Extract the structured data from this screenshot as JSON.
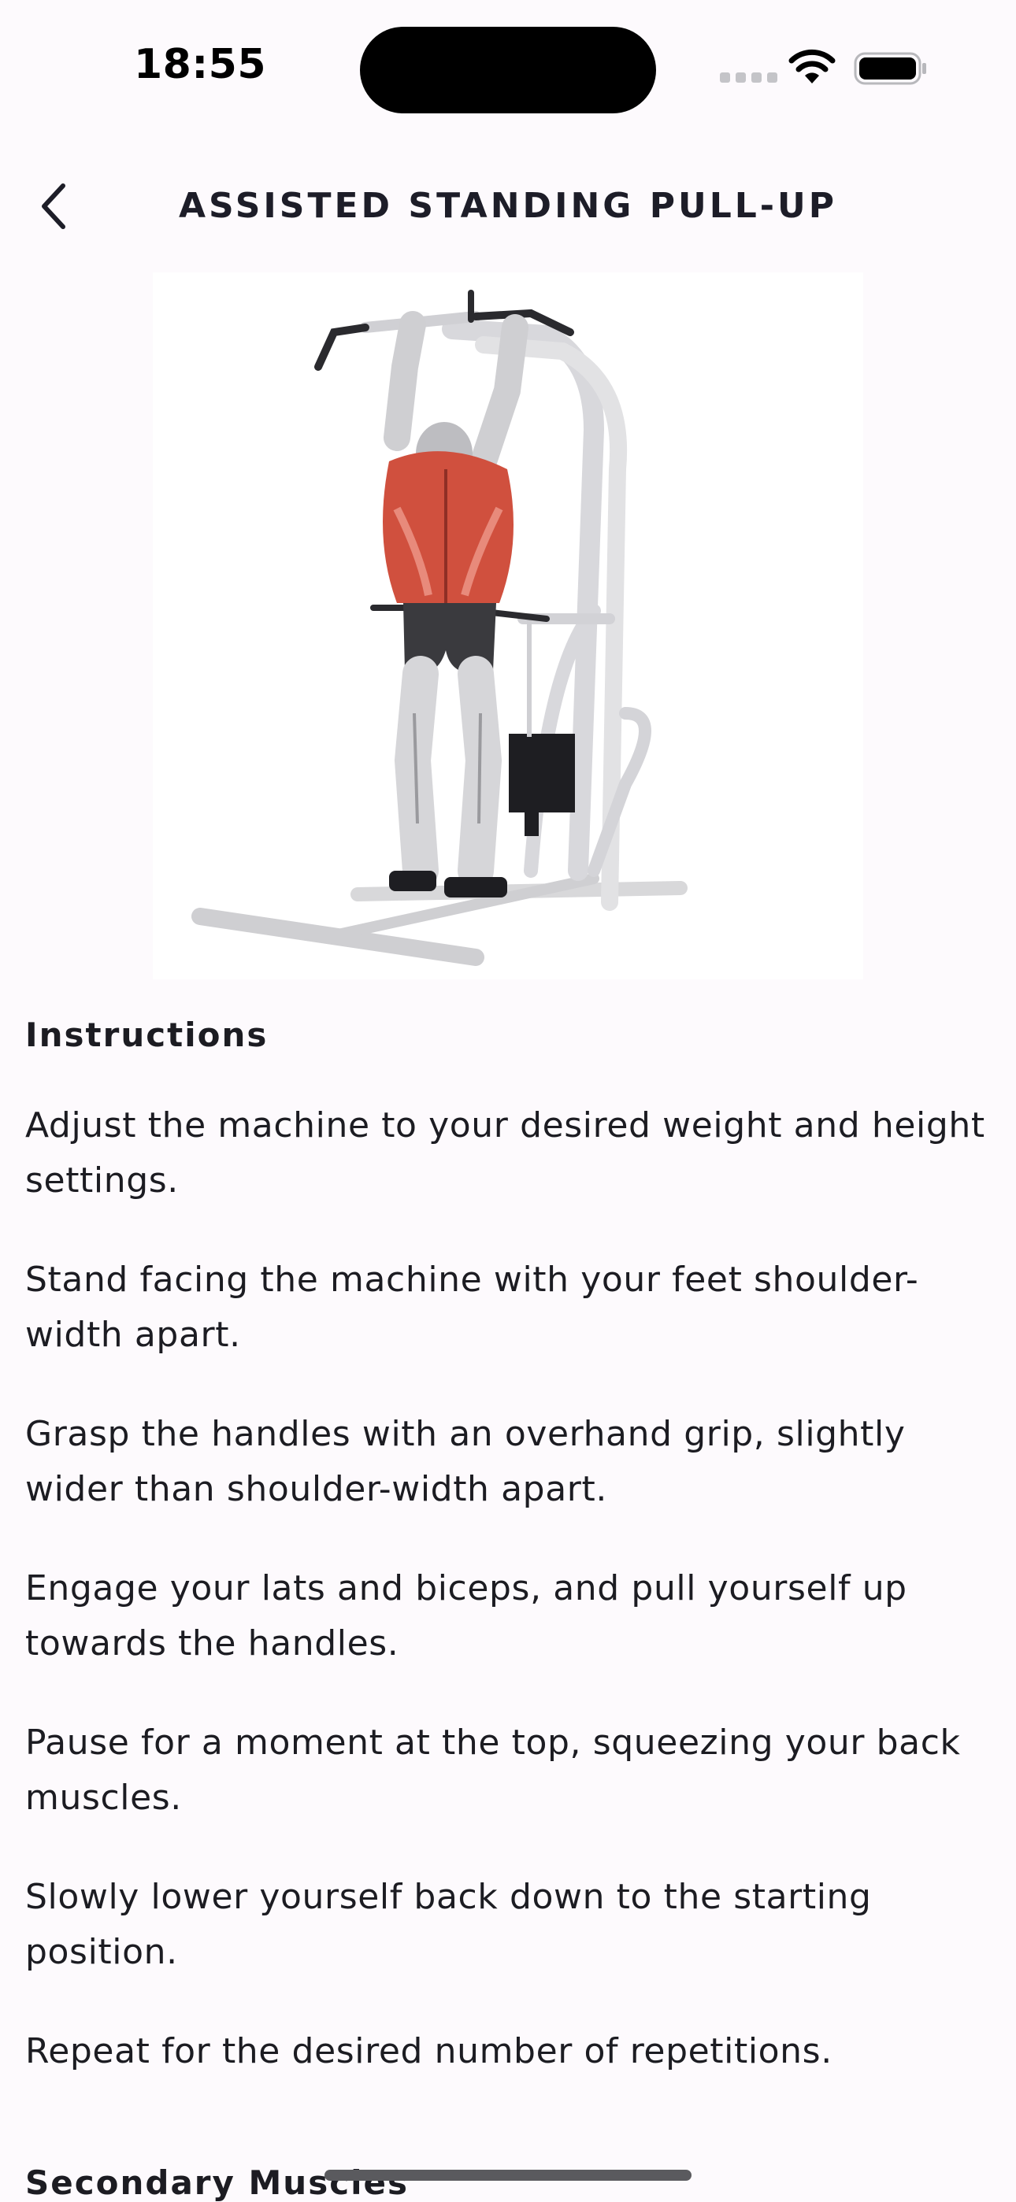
{
  "status_bar": {
    "time": "18:55"
  },
  "header": {
    "title": "ASSISTED STANDING PULL-UP",
    "back_icon": "chevron-left-icon"
  },
  "illustration": {
    "subject": "exercise-illustration",
    "highlight_color": "#d0503e"
  },
  "instructions": {
    "heading": "Instructions",
    "steps": [
      "Adjust the machine to your desired weight and height settings.",
      "Stand facing the machine with your feet shoulder-width apart.",
      "Grasp the handles with an overhand grip, slightly wider than shoulder-width apart.",
      "Engage your lats and biceps, and pull yourself up towards the handles.",
      "Pause for a moment at the top, squeezing your back muscles.",
      "Slowly lower yourself back down to the starting position.",
      "Repeat for the desired number of repetitions."
    ]
  },
  "secondary_muscles": {
    "heading": "Secondary Muscles"
  }
}
